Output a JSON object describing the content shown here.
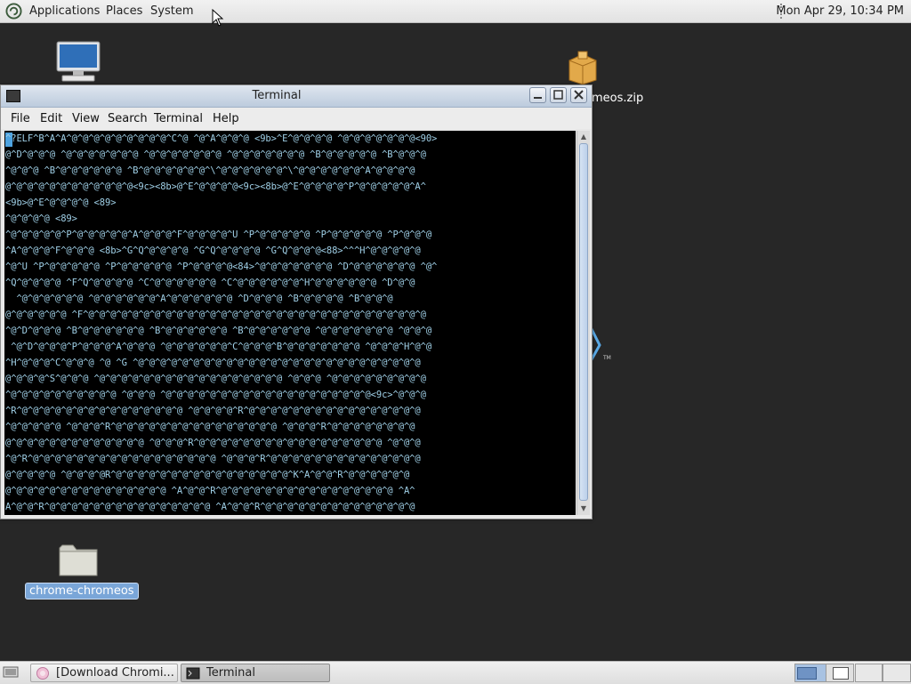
{
  "top_panel": {
    "menus": [
      "Applications",
      "Places",
      "System"
    ],
    "clock": "Mon Apr 29, 10:34 PM"
  },
  "desktop": {
    "icons": [
      {
        "name": "computer",
        "label": ""
      },
      {
        "name": "zip-archive",
        "label": "meos.zip"
      },
      {
        "name": "folder",
        "label": "chrome-chromeos"
      }
    ]
  },
  "terminal": {
    "title": "Terminal",
    "menu": [
      "File",
      "Edit",
      "View",
      "Search",
      "Terminal",
      "Help"
    ],
    "lines": [
      "^?ELF^B^A^A^@^@^@^@^@^@^@^@^@^C^@ ^@^A^@^@^@ <9b>^E^@^@^@^@ ^@^@^@^@^@^@^@<90>",
      "@^D^@^@^@ ^@^@^@^@^@^@^@ ^@^@^@^@^@^@^@ ^@^@^@^@^@^@^@ ^B^@^@^@^@^@ ^B^@^@^@",
      "^@^@^@ ^B^@^@^@^@^@^@ ^B^@^@^@^@^@^@^\\^@^@^@^@^@^@^\\^@^@^@^@^@^@^A^@^@^@^@",
      "@^@^@^@^@^@^@^@^@^@^@^@<9c><8b>@^E^@^@^@^@<9c><8b>@^E^@^@^@^@^P^@^@^@^@^@^A^",
      "<9b>@^E^@^@^@^@ <89>",
      "^@^@^@^@ <89>",
      "^@^@^@^@^@^P^@^@^@^@^@^A^@^@^@^F^@^@^@^@^U ^P^@^@^@^@^@ ^P^@^@^@^@^@ ^P^@^@^@",
      "^A^@^@^@^F^@^@^@ <8b>^G^Q^@^@^@^@ ^G^Q^@^@^@^@ ^G^Q^@^@^@<88>^^^H^@^@^@^@^@",
      "^@^U ^P^@^@^@^@^@ ^P^@^@^@^@^@ ^P^@^@^@^@<84>^@^@^@^@^@^@^@ ^D^@^@^@^@^@^@ ^@^",
      "^Q^@^@^@^@ ^F^Q^@^@^@^@ ^C^@^@^@^@^@^@ ^C^@^@^@^@^@^@^H^@^@^@^@^@^@ ^D^@^@",
      "  ^@^@^@^@^@^@ ^@^@^@^@^@^@^A^@^@^@^@^@^@ ^D^@^@^@ ^B^@^@^@^@ ^B^@^@^@",
      "@^@^@^@^@^@ ^F^@^@^@^@^@^@^@^@^@^@^@^@^@^@^@^@^@^@^@^@^@^@^@^@^@^@^@^@^@^@^@",
      "^@^D^@^@^@ ^B^@^@^@^@^@^@ ^B^@^@^@^@^@^@ ^B^@^@^@^@^@^@ ^@^@^@^@^@^@^@ ^@^@^@",
      " ^@^D^@^@^@^P^@^@^@^A^@^@^@ ^@^@^@^@^@^@^C^@^@^@^B^@^@^@^@^@^@^@ ^@^@^@^H^@^@",
      "^H^@^@^@^C^@^@^@ ^@ ^G ^@^@^@^@^@^@^@^@^@^@^@^@^@^@^@^@^@^@^@^@^@^@^@^@^@^@",
      "@^@^@^@^S^@^@^@ ^@^@^@^@^@^@^@^@^@^@^@^@^@^@^@^@^@ ^@^@^@ ^@^@^@^@^@^@^@^@^@",
      "^@^@^@^@^@^@^@^@^@^@ ^@^@^@ ^@^@^@^@^@^@^@^@^@^@^@^@^@^@^@^@^@^@^@<9c>^@^@^@",
      "^R^@^@^@^@^@^@^@^@^@^@^@^@^@^@^@ ^@^@^@^@^R^@^@^@^@^@^@^@^@^@^@^@^@^@^@^@^@",
      "^@^@^@^@^@ ^@^@^@^R^@^@^@^@^@^@^@^@^@^@^@^@^@^@^@ ^@^@^@^R^@^@^@^@^@^@^@^@",
      "@^@^@^@^@^@^@^@^@^@^@^@^@ ^@^@^@^R^@^@^@^@^@^@^@^@^@^@^@^@^@^@^@^@^@ ^@^@^@",
      "^@^R^@^@^@^@^@^@^@^@^@^@^@^@^@^@^@^@^@ ^@^@^@^R^@^@^@^@^@^@^@^@^@^@^@^@^@^@",
      "@^@^@^@^@ ^@^@^@^@R^@^@^@^@^@^@^@^@^@^@^@^@^@^@^@^@^K^A^@^@^R^@^@^@^@^@^@",
      "@^@^@^@^@^@^@^@^@^@^@^@^@^@^@ ^A^@^@^R^@^@^@^@^@^@^@^@^@^@^@^@^@^@^@^@ ^A^",
      "A^@^@^R^@^@^@^@^@^@^@^@^@^@^@^@^@^@^@ ^A^@^@^R^@^@^@^@^@^@^@^@^@^@^@^@^@^@"
    ]
  },
  "taskbar": {
    "buttons": [
      "[Download Chromi...",
      "Terminal"
    ]
  },
  "colors": {
    "desktop_bg": "#272727",
    "terminal_bg": "#000000",
    "terminal_fg": "#9fcfe6",
    "selection": "#7aa6d8"
  }
}
